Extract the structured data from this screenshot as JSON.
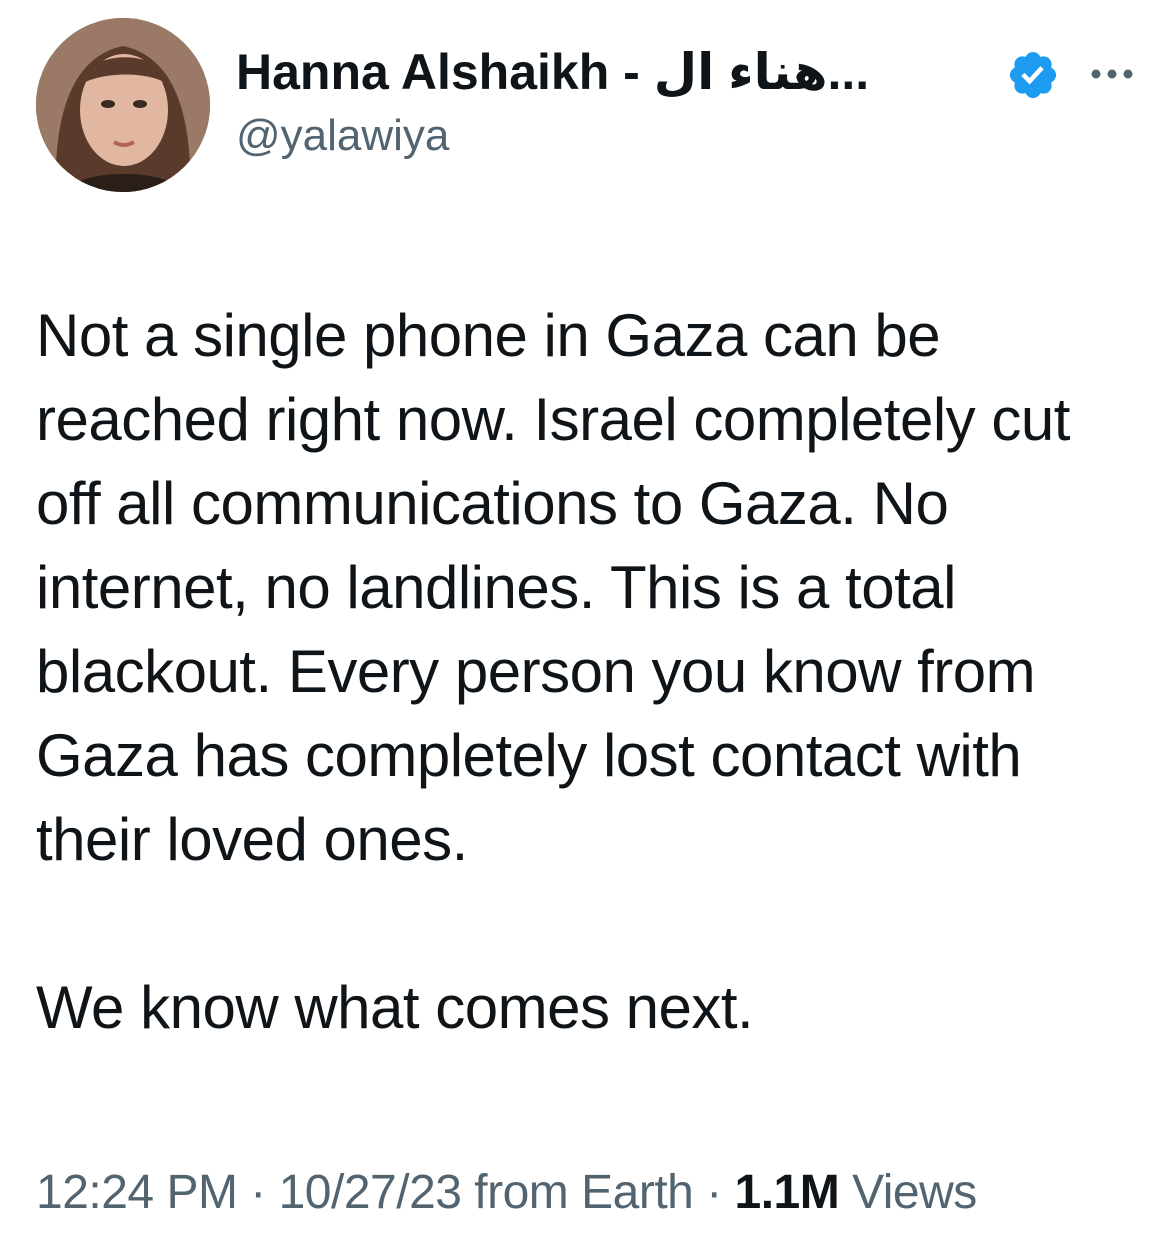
{
  "tweet": {
    "author": {
      "display_name": "Hanna Alshaikh - هناء ال...",
      "handle": "@yalawiya",
      "verified": true
    },
    "text_paragraphs": [
      "Not a single phone in Gaza can be reached right now. Israel completely cut off all communications to Gaza. No internet, no landlines. This is a total blackout. Every person you know from Gaza has completely lost contact with their loved ones.",
      "We know what comes next."
    ],
    "meta": {
      "time": "12:24 PM",
      "separator": " · ",
      "date": "10/27/23",
      "source": " from Earth",
      "views_count": "1.1M",
      "views_label": " Views"
    }
  },
  "icons": {
    "verified": "verified-badge-icon",
    "more": "more-horizontal-icon"
  },
  "colors": {
    "text_primary": "#0f1419",
    "text_secondary": "#536471",
    "verified_blue": "#1d9bf0"
  }
}
